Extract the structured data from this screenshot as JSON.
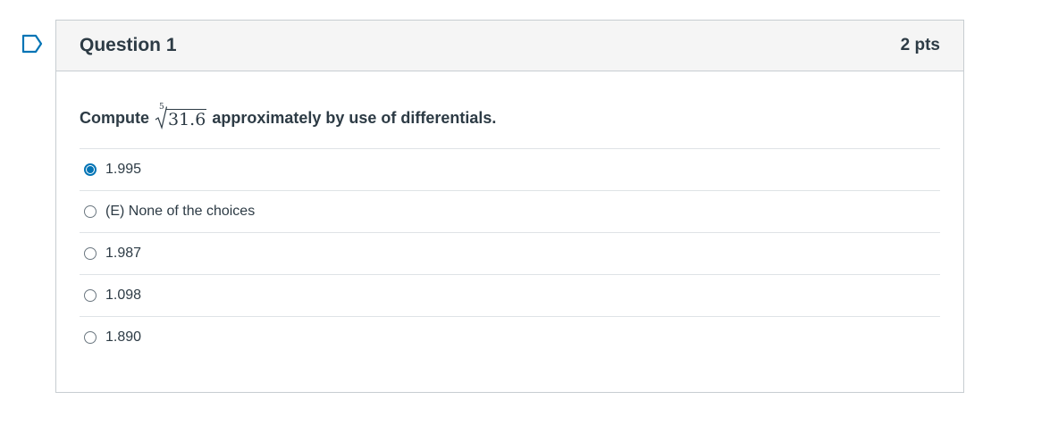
{
  "question": {
    "title": "Question 1",
    "points": "2 pts",
    "text_before": "Compute",
    "radical_index": "5",
    "radicand": "31.6",
    "text_after": "approximately by use of differentials."
  },
  "answers": [
    {
      "label": "1.995",
      "selected": true
    },
    {
      "label": "(E) None of the choices",
      "selected": false
    },
    {
      "label": "1.987",
      "selected": false
    },
    {
      "label": "1.098",
      "selected": false
    },
    {
      "label": "1.890",
      "selected": false
    }
  ],
  "icons": {
    "flag": "flag-question-icon"
  },
  "colors": {
    "accent": "#0374b5",
    "text": "#2d3b45",
    "border": "#c7cdd1",
    "header_bg": "#f5f5f5"
  }
}
